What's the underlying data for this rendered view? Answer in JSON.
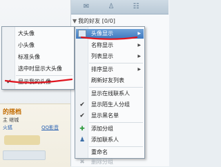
{
  "main_panel": {
    "group_header": "我的好友 [0/0]",
    "group_arrow": "▼"
  },
  "left_panel": {
    "user_name": "的搭档",
    "user_status": "主 继城",
    "link_left": "火狐",
    "link_right": "QQ影音"
  },
  "submenu": {
    "items": [
      {
        "label": "大头像",
        "checked": false
      },
      {
        "label": "小头像",
        "checked": false
      },
      {
        "label": "标准头像",
        "checked": false
      },
      {
        "label": "选中时显示大头像",
        "checked": false
      },
      {
        "label": "显示我的头像",
        "checked": true
      }
    ]
  },
  "main_menu": {
    "items": [
      {
        "label": "头像显示",
        "icon": "avatar-display-icon",
        "has_submenu": true,
        "highlighted": true
      },
      {
        "label": "名称显示",
        "has_submenu": true
      },
      {
        "label": "列表显示",
        "has_submenu": true
      },
      {
        "label": "排序显示",
        "has_submenu": true
      },
      {
        "label": "刷新好友列表"
      },
      {
        "label": "显示在线联系人",
        "checked": false
      },
      {
        "label": "显示陌生人分组",
        "checked": true
      },
      {
        "label": "显示黑名单",
        "checked": true
      },
      {
        "label": "添加分组",
        "icon": "chat-add-icon"
      },
      {
        "label": "添加联系人",
        "icon": "people-icon"
      },
      {
        "label": "重命名"
      },
      {
        "label": "删除分组",
        "disabled": true
      }
    ]
  },
  "colors": {
    "highlight": "#3f79bf",
    "annotation": "#e0141e"
  }
}
